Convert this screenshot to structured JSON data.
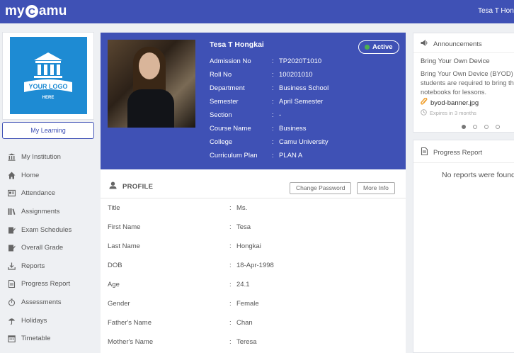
{
  "app": {
    "logo_left": "my",
    "logo_c": "C",
    "logo_right": "amu"
  },
  "header": {
    "user_name": "Tesa T Hongkai"
  },
  "sidebar": {
    "my_learning": "My Learning",
    "logo_text": {
      "line1": "YOUR LOGO",
      "line2": "HERE"
    },
    "items": [
      {
        "label": "My Institution",
        "icon": "institution-icon"
      },
      {
        "label": "Home",
        "icon": "home-icon"
      },
      {
        "label": "Attendance",
        "icon": "attendance-icon"
      },
      {
        "label": "Assignments",
        "icon": "assignments-icon"
      },
      {
        "label": "Exam Schedules",
        "icon": "exam-icon"
      },
      {
        "label": "Overall Grade",
        "icon": "grade-icon"
      },
      {
        "label": "Reports",
        "icon": "download-icon"
      },
      {
        "label": "Progress Report",
        "icon": "document-icon"
      },
      {
        "label": "Assessments",
        "icon": "stopwatch-icon"
      },
      {
        "label": "Holidays",
        "icon": "umbrella-icon"
      },
      {
        "label": "Timetable",
        "icon": "calendar-icon"
      }
    ]
  },
  "student": {
    "name": "Tesa T Hongkai",
    "status": "Active",
    "details": [
      {
        "label": "Admission No",
        "value": "TP2020T1010"
      },
      {
        "label": "Roll No",
        "value": "100201010"
      },
      {
        "label": "Department",
        "value": "Business School"
      },
      {
        "label": "Semester",
        "value": "April Semester"
      },
      {
        "label": "Section",
        "value": "-"
      },
      {
        "label": "Course Name",
        "value": "Business"
      },
      {
        "label": "College",
        "value": "Camu University"
      },
      {
        "label": "Curriculum Plan",
        "value": "PLAN A"
      }
    ]
  },
  "profile": {
    "title": "PROFILE",
    "change_password": "Change Password",
    "more_info": "More Info",
    "fields": [
      {
        "label": "Title",
        "value": "Ms."
      },
      {
        "label": "First Name",
        "value": "Tesa"
      },
      {
        "label": "Last Name",
        "value": "Hongkai"
      },
      {
        "label": "DOB",
        "value": "18-Apr-1998"
      },
      {
        "label": "Age",
        "value": "24.1"
      },
      {
        "label": "Gender",
        "value": "Female"
      },
      {
        "label": "Father's Name",
        "value": "Chan"
      },
      {
        "label": "Mother's Name",
        "value": "Teresa"
      }
    ]
  },
  "announcements": {
    "title": "Announcements",
    "item_title": "Bring Your Own Device",
    "item_body": "Bring Your Own Device (BYOD) students are required to bring their notebooks for lessons.",
    "attachment": "byod-banner.jpg",
    "expires": "Expires in 3 months"
  },
  "progress_report": {
    "title": "Progress Report",
    "empty": "No reports were found"
  },
  "colors": {
    "brand": "#3f51b5",
    "status_dot": "#4caf50",
    "logo_bg": "#1e8bd3"
  }
}
